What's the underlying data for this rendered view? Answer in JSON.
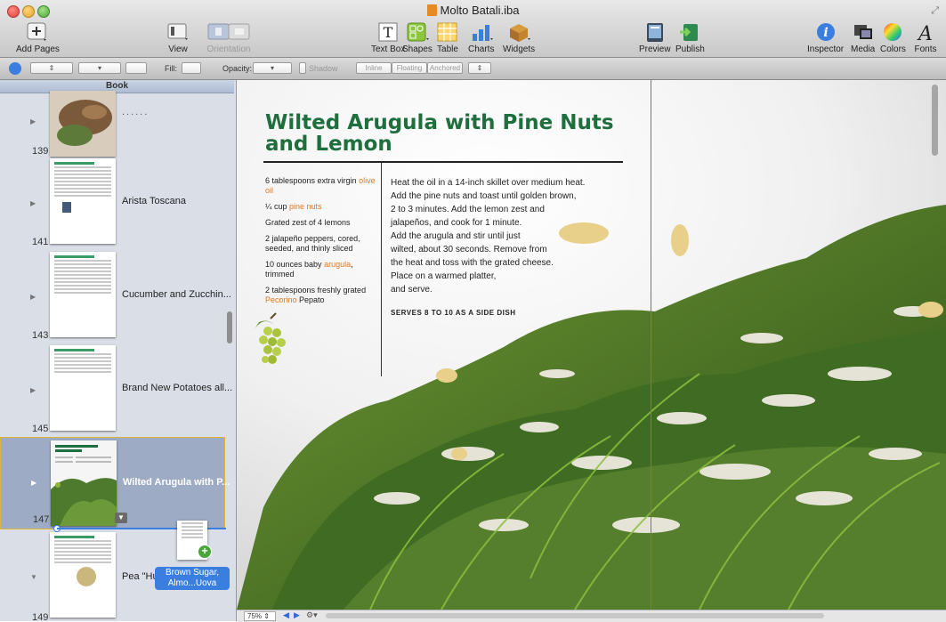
{
  "window": {
    "title": "Molto Batali.iba"
  },
  "toolbar": {
    "add_pages": "Add Pages",
    "view": "View",
    "orientation": "Orientation",
    "text_box": "Text Box",
    "shapes": "Shapes",
    "table": "Table",
    "charts": "Charts",
    "widgets": "Widgets",
    "preview": "Preview",
    "publish": "Publish",
    "inspector": "Inspector",
    "media": "Media",
    "colors": "Colors",
    "fonts": "Fonts"
  },
  "format_bar": {
    "fill_label": "Fill:",
    "opacity_label": "Opacity:",
    "shadow_label": "Shadow",
    "inline": "Inline",
    "floating": "Floating",
    "anchored": "Anchored"
  },
  "sidebar": {
    "header": "Book",
    "rows": [
      {
        "page": "139",
        "label": "......"
      },
      {
        "page": "141",
        "label": "Arista Toscana"
      },
      {
        "page": "143",
        "label": "Cucumber and Zucchin..."
      },
      {
        "page": "145",
        "label": "Brand New Potatoes all..."
      },
      {
        "page": "147",
        "label": "Wilted Arugula with P..."
      },
      {
        "page": "149",
        "label": "Pea \"Hur"
      }
    ],
    "drag_badge_line1": "Brown Sugar,",
    "drag_badge_line2": "Almo...Uova",
    "drag_plus": "+"
  },
  "recipe": {
    "title": "Wilted Arugula with Pine Nuts and Lemon",
    "ingredients": [
      {
        "pre": "6 tablespoons extra virgin ",
        "hl": "olive oil",
        "post": ""
      },
      {
        "pre": "¼ cup ",
        "hl": "pine nuts",
        "post": ""
      },
      {
        "pre": "Grated zest of 4 lemons",
        "hl": "",
        "post": ""
      },
      {
        "pre": "2 jalapeño peppers, cored, seeded, and thinly sliced",
        "hl": "",
        "post": ""
      },
      {
        "pre": "10 ounces baby ",
        "hl": "arugula",
        "post": ", trimmed"
      },
      {
        "pre": "2 tablespoons freshly grated ",
        "hl": "Pecorino",
        "post": " Pepato"
      }
    ],
    "directions": [
      "Heat the oil in a 14-inch skillet over medium heat.",
      "Add the pine nuts and toast until golden brown,",
      "2 to 3 minutes. Add the lemon zest and",
      "jalapeños, and cook for 1 minute.",
      "Add the arugula and stir until just",
      "wilted, about 30 seconds. Remove from",
      "the heat and toss with the grated cheese.",
      "Place on a warmed platter,",
      "and serve."
    ],
    "serves": "SERVES 8 TO 10 AS A SIDE DISH"
  },
  "bottom_bar": {
    "zoom": "75%"
  },
  "colors": {
    "accent_green": "#1f6f3e",
    "highlight_orange": "#e07a22",
    "selection_blue": "#3a7ee0"
  }
}
